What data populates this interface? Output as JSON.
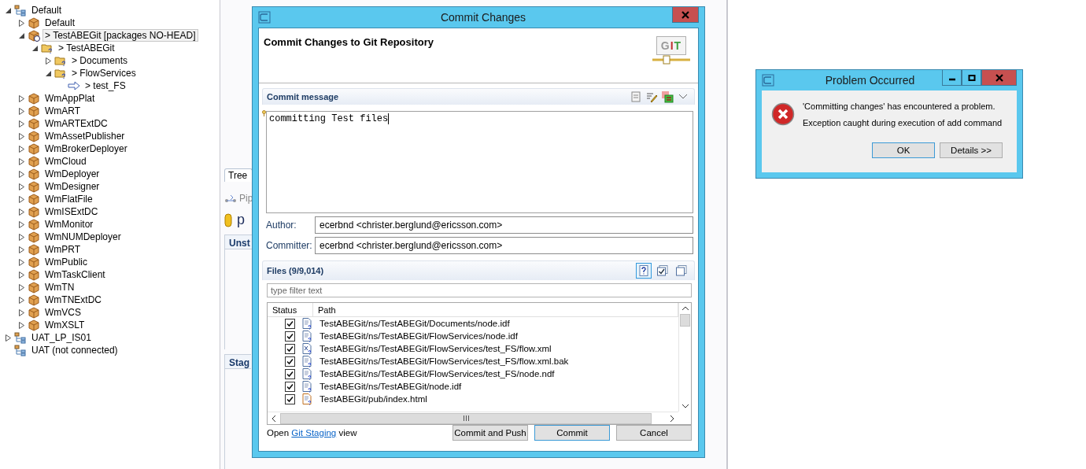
{
  "tree": [
    {
      "label": "Default",
      "kind": "server",
      "expanded": true,
      "selected": false,
      "children": [
        {
          "label": "Default",
          "kind": "package",
          "expanded": false,
          "selected": false
        },
        {
          "label": "> TestABEGit  [packages NO-HEAD]",
          "kind": "package-git",
          "expanded": true,
          "selected": true,
          "children": [
            {
              "label": "> TestABEGit",
              "kind": "folder",
              "expanded": true,
              "selected": false,
              "children": [
                {
                  "label": "> Documents",
                  "kind": "folder",
                  "expanded": false,
                  "selected": false
                },
                {
                  "label": "> FlowServices",
                  "kind": "folder",
                  "expanded": true,
                  "selected": false,
                  "children": [
                    {
                      "label": "> test_FS",
                      "kind": "service",
                      "selected": false
                    }
                  ]
                }
              ]
            }
          ]
        },
        {
          "label": "WmAppPlat",
          "kind": "package",
          "expanded": false,
          "selected": false
        },
        {
          "label": "WmART",
          "kind": "package",
          "expanded": false,
          "selected": false
        },
        {
          "label": "WmARTExtDC",
          "kind": "package",
          "expanded": false,
          "selected": false
        },
        {
          "label": "WmAssetPublisher",
          "kind": "package",
          "expanded": false,
          "selected": false
        },
        {
          "label": "WmBrokerDeployer",
          "kind": "package",
          "expanded": false,
          "selected": false
        },
        {
          "label": "WmCloud",
          "kind": "package",
          "expanded": false,
          "selected": false
        },
        {
          "label": "WmDeployer",
          "kind": "package",
          "expanded": false,
          "selected": false
        },
        {
          "label": "WmDesigner",
          "kind": "package",
          "expanded": false,
          "selected": false
        },
        {
          "label": "WmFlatFile",
          "kind": "package",
          "expanded": false,
          "selected": false
        },
        {
          "label": "WmISExtDC",
          "kind": "package",
          "expanded": false,
          "selected": false
        },
        {
          "label": "WmMonitor",
          "kind": "package",
          "expanded": false,
          "selected": false
        },
        {
          "label": "WmNUMDeployer",
          "kind": "package",
          "expanded": false,
          "selected": false
        },
        {
          "label": "WmPRT",
          "kind": "package",
          "expanded": false,
          "selected": false
        },
        {
          "label": "WmPublic",
          "kind": "package",
          "expanded": false,
          "selected": false
        },
        {
          "label": "WmTaskClient",
          "kind": "package",
          "expanded": false,
          "selected": false
        },
        {
          "label": "WmTN",
          "kind": "package",
          "expanded": false,
          "selected": false
        },
        {
          "label": "WmTNExtDC",
          "kind": "package",
          "expanded": false,
          "selected": false
        },
        {
          "label": "WmVCS",
          "kind": "package",
          "expanded": false,
          "selected": false
        },
        {
          "label": "WmXSLT",
          "kind": "package",
          "expanded": false,
          "selected": false
        }
      ]
    },
    {
      "label": "UAT_LP_IS01",
      "kind": "server",
      "expanded": false,
      "selected": false
    },
    {
      "label": "UAT (not connected)",
      "kind": "server",
      "selected": false
    }
  ],
  "background": {
    "tab": "Tree",
    "pipeline_label": "Pip",
    "title_fragment": "p",
    "sections": [
      "Unst",
      "Stag"
    ]
  },
  "commit_dialog": {
    "title": "Commit Changes",
    "heading": "Commit Changes to Git Repository",
    "logo_text": "GIT",
    "message_section": "Commit message",
    "message": "committing Test files",
    "author_label": "Author:",
    "author": "ecerbnd <christer.berglund@ericsson.com>",
    "committer_label": "Committer:",
    "committer": "ecerbnd <christer.berglund@ericsson.com>",
    "files_section": "Files (9/9,014)",
    "filter_toggles": [
      {
        "kind": "untracked",
        "selected": true
      },
      {
        "kind": "check-all",
        "selected": false
      },
      {
        "kind": "uncheck-all",
        "selected": false
      }
    ],
    "filter_placeholder": "type filter text",
    "columns": [
      "Status",
      "Path"
    ],
    "files": [
      {
        "path": "TestABEGit/ns/TestABEGit/Documents/node.idf",
        "kind": "file",
        "checked": true
      },
      {
        "path": "TestABEGit/ns/TestABEGit/FlowServices/node.idf",
        "kind": "file",
        "checked": true
      },
      {
        "path": "TestABEGit/ns/TestABEGit/FlowServices/test_FS/flow.xml",
        "kind": "xml",
        "checked": true
      },
      {
        "path": "TestABEGit/ns/TestABEGit/FlowServices/test_FS/flow.xml.bak",
        "kind": "file",
        "checked": true
      },
      {
        "path": "TestABEGit/ns/TestABEGit/FlowServices/test_FS/node.ndf",
        "kind": "file",
        "checked": true
      },
      {
        "path": "TestABEGit/ns/TestABEGit/node.idf",
        "kind": "file",
        "checked": true
      },
      {
        "path": "TestABEGit/pub/index.html",
        "kind": "html",
        "checked": true
      }
    ],
    "footer": {
      "prefix": "Open",
      "link": "Git Staging",
      "suffix": "view"
    },
    "buttons": [
      {
        "label": "Commit and Push",
        "default": false
      },
      {
        "label": "Commit",
        "default": true
      },
      {
        "label": "Cancel",
        "default": false
      }
    ]
  },
  "problem_dialog": {
    "title": "Problem Occurred",
    "message": "'Committing changes' has encountered a problem.",
    "detail": "Exception caught during execution of add command",
    "buttons": [
      {
        "label": "OK",
        "default": true
      },
      {
        "label": "Details >>",
        "default": false
      }
    ]
  }
}
